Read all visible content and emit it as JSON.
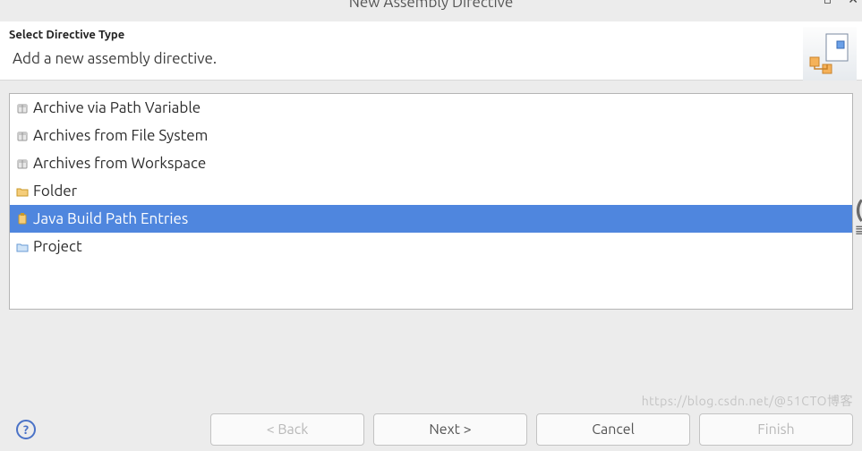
{
  "window": {
    "title": "New Assembly Directive"
  },
  "header": {
    "title": "Select Directive Type",
    "description": "Add a new assembly directive."
  },
  "list": {
    "items": [
      {
        "label": "Archive via Path Variable",
        "icon": "archive",
        "selected": false
      },
      {
        "label": "Archives from File System",
        "icon": "archive",
        "selected": false
      },
      {
        "label": "Archives from Workspace",
        "icon": "archive",
        "selected": false
      },
      {
        "label": "Folder",
        "icon": "folder",
        "selected": false
      },
      {
        "label": "Java Build Path Entries",
        "icon": "jar",
        "selected": true
      },
      {
        "label": "Project",
        "icon": "project",
        "selected": false
      }
    ]
  },
  "buttons": {
    "back": "< Back",
    "next": "Next >",
    "cancel": "Cancel",
    "finish": "Finish"
  },
  "watermark": "https://blog.csdn.net/@51CTO博客"
}
